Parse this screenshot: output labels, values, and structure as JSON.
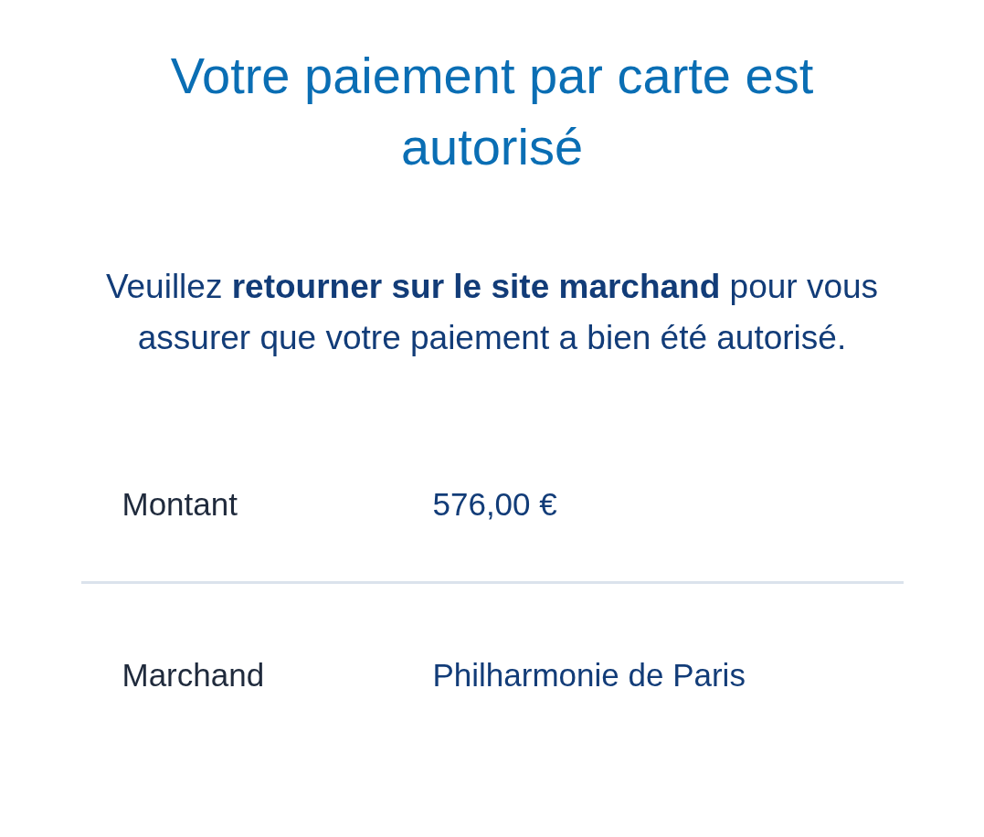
{
  "title": "Votre paiement par carte est autorisé",
  "message": "Veuillez **retourner sur le site marchand** pour vous assurer que votre paiement a bien été autorisé.",
  "details": [
    {
      "label": "Montant",
      "value": "576,00 €"
    },
    {
      "label": "Marchand",
      "value": "Philharmonie de Paris"
    }
  ]
}
